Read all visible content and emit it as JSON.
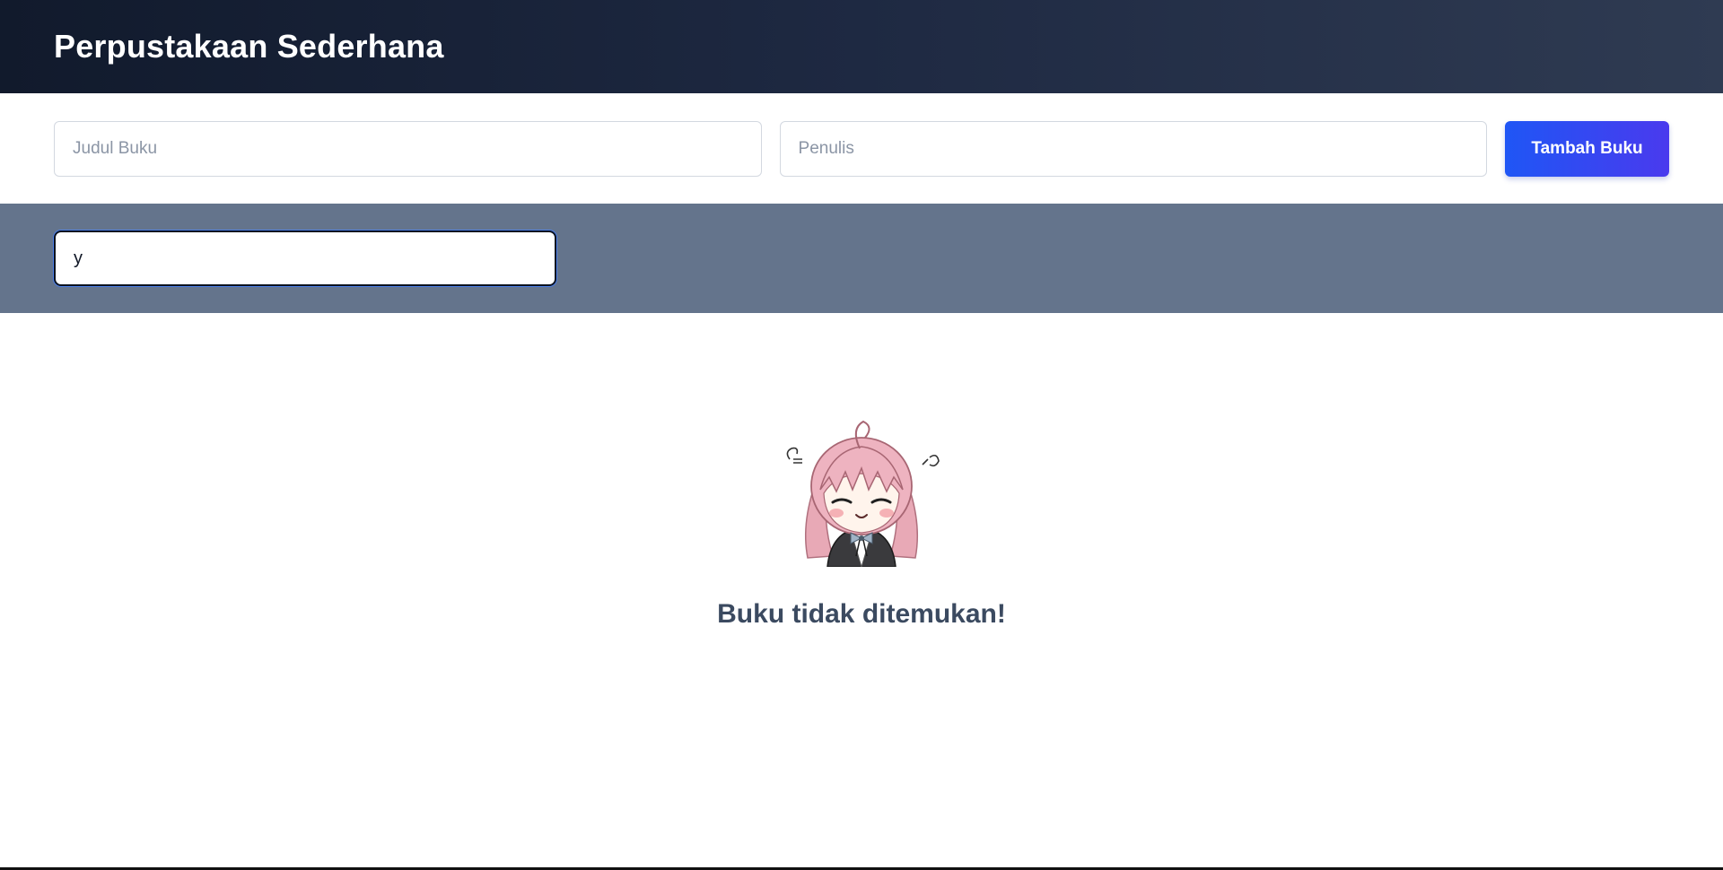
{
  "app": {
    "title": "Perpustakaan Sederhana"
  },
  "form": {
    "title_placeholder": "Judul Buku",
    "author_placeholder": "Penulis",
    "add_button_label": "Tambah Buku"
  },
  "search": {
    "value": "y"
  },
  "empty_state": {
    "illustration": "chibi-girl-sticker",
    "message": "Buku tidak ditemukan!"
  },
  "colors": {
    "header_start": "#111a2c",
    "header_end": "#2f3b52",
    "button_start": "#1f56f5",
    "button_end": "#4a3aee",
    "search_band": "#64748c",
    "empty_text": "#3b4a60"
  }
}
